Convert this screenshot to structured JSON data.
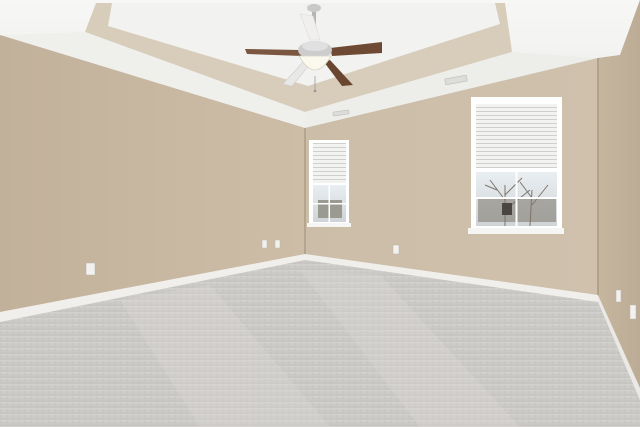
{
  "scene": {
    "subject": "empty-room-interior",
    "colors": {
      "wall_left": "#c7b7a0",
      "wall_back": "#cdbfa9",
      "wall_right": "#c2b29b",
      "ceiling": "#f4f4f2",
      "tray_band": "#d9cdbc",
      "carpet": "#c9c7c4",
      "baseboard": "#f1efec",
      "window_frame": "#ffffff",
      "blinds": "#eeeeec",
      "fan_blade": "#6e4a35",
      "fan_metal": "#c9c9c9"
    },
    "elements": [
      "tray-ceiling",
      "ceiling-fan",
      "small-window",
      "large-window",
      "wall-outlets",
      "baseboards",
      "carpet-floor"
    ]
  }
}
